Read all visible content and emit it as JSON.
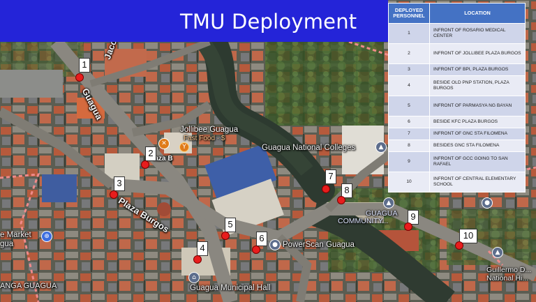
{
  "title": "TMU Deployment",
  "colors": {
    "title_bar": "#2424d8",
    "table_header": "#4472c4",
    "table_row_dark": "#cfd5ea",
    "table_row_light": "#e9ebf5",
    "marker": "#e81d1d"
  },
  "table": {
    "headers": {
      "personnel": "DEPLOYED PERSONNEL",
      "location": "LOCATION"
    },
    "rows": [
      {
        "num": "1",
        "location": "INFRONT OF ROSARIO MEDICAL CENTER"
      },
      {
        "num": "2",
        "location": "INFRONT OF JOLLIBEE PLAZA BURGOS"
      },
      {
        "num": "3",
        "location": "INFRONT OF BPI, PLAZA BURGOS"
      },
      {
        "num": "4",
        "location": "BESIDE OLD PNP STATION, PLAZA BURGOS"
      },
      {
        "num": "5",
        "location": "INFRONT OF PARMASYA NG BAYAN"
      },
      {
        "num": "6",
        "location": "BESIDE KFC PLAZA BURGOS"
      },
      {
        "num": "7",
        "location": "INFRONT OF GNC STA FILOMENA"
      },
      {
        "num": "8",
        "location": "BESIDES GNC STA FILOMENA"
      },
      {
        "num": "9",
        "location": "INFRONT OF GCC GOING TO SAN RAFAEL"
      },
      {
        "num": "10",
        "location": "INFRONT OF CENTRAL ELEMENTARY SCHOOL"
      }
    ]
  },
  "map_labels": {
    "street_guagua": "Guagua",
    "street_plaza_burgos": "Plaza Burgos",
    "street_top": "Jacolo",
    "street_left_top": "Guagua",
    "jollibee_name": "Jollibee Guagua",
    "jollibee_type": "Fast Food · $",
    "national_colleges": "Guagua National Colleges",
    "community_line1": "GUAGUA",
    "community_line2": "COMMUNITY...",
    "powerscan": "PowerScan Guagua",
    "municipal_hall": "Guagua Municipal Hall",
    "market": "e Market",
    "market_sub": "gua",
    "anga": "ANGA GUAGUA",
    "guillermo_line1": "Guillermo D...",
    "guillermo_line2": "National Hi...",
    "plaza_bur_small": "Plaza B"
  },
  "markers": [
    "1",
    "2",
    "3",
    "4",
    "5",
    "6",
    "7",
    "8",
    "9",
    "10"
  ],
  "icons": {
    "jollibee": "fork-knife-icon",
    "school": "school-icon",
    "community": "school-icon",
    "powerscan": "location-pin-icon",
    "municipal_hall": "government-icon",
    "market": "cart-icon",
    "guillermo": "school-icon",
    "right_pin": "location-pin-icon"
  }
}
